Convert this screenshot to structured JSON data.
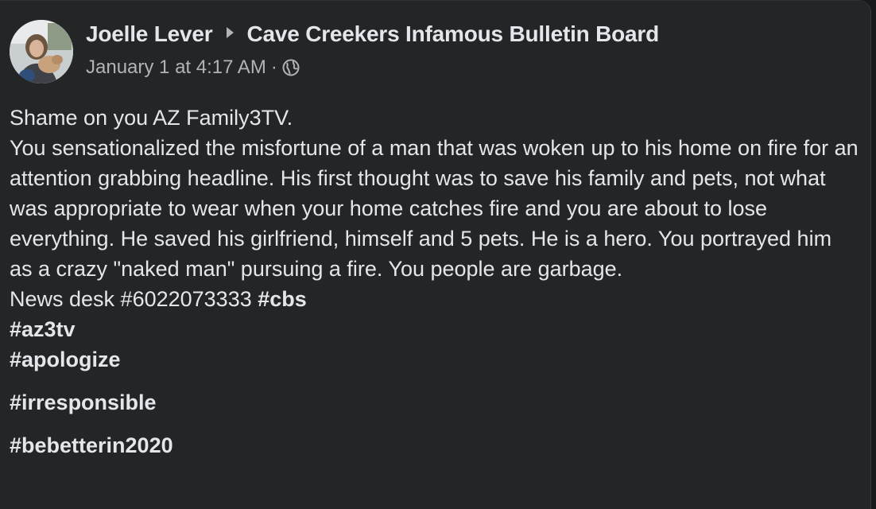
{
  "post": {
    "author_name": "Joelle Lever",
    "group_name": "Cave Creekers Infamous Bulletin Board",
    "timestamp": "January 1 at 4:17 AM",
    "separator": "·",
    "privacy_icon": "globe-icon",
    "body": {
      "line_1": "Shame on you AZ Family3TV.",
      "paragraph": "You sensationalized the misfortune of a man that was woken up to his home on fire for an attention grabbing headline. His first thought was to save his family and pets, not what was  appropriate to wear when your home catches fire and you are about to lose everything. He saved his girlfriend, himself and 5 pets. He is a hero. You portrayed him as a crazy \"naked man\" pursuing a fire.  You people are garbage.",
      "news_desk": "News desk #6022073333",
      "hashtags": [
        "#cbs",
        "#az3tv",
        "#apologize",
        "#irresponsible",
        "#bebetterin2020"
      ]
    }
  },
  "colors": {
    "card_background": "#242526",
    "primary_text": "#e4e6eb",
    "secondary_text": "#b0b3b8"
  }
}
